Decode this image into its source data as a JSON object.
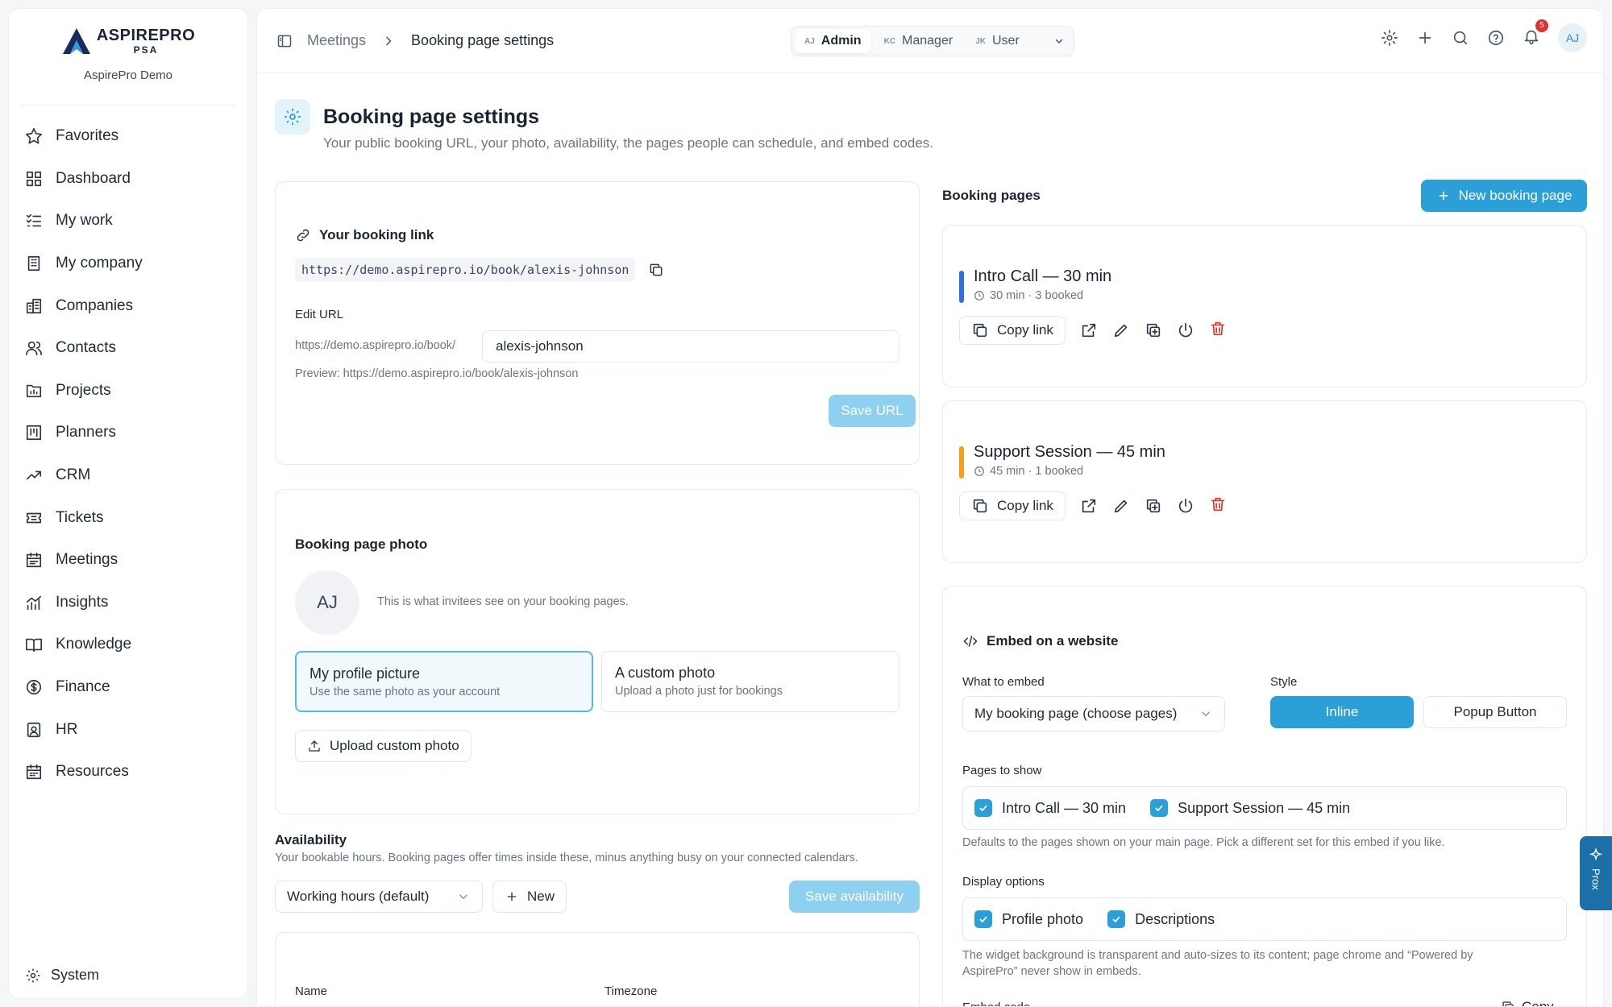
{
  "brand": {
    "name": "ASPIREPRO",
    "sub": "PSA",
    "org": "AspirePro Demo"
  },
  "nav": [
    {
      "label": "Favorites",
      "icon": "star-icon"
    },
    {
      "label": "Dashboard",
      "icon": "grid-icon"
    },
    {
      "label": "My work",
      "icon": "list-check-icon"
    },
    {
      "label": "My company",
      "icon": "building-icon"
    },
    {
      "label": "Companies",
      "icon": "buildings-icon"
    },
    {
      "label": "Contacts",
      "icon": "users-icon"
    },
    {
      "label": "Projects",
      "icon": "folder-chart-icon"
    },
    {
      "label": "Planners",
      "icon": "kanban-icon"
    },
    {
      "label": "CRM",
      "icon": "trend-up-icon"
    },
    {
      "label": "Tickets",
      "icon": "ticket-icon"
    },
    {
      "label": "Meetings",
      "icon": "calendar-icon"
    },
    {
      "label": "Insights",
      "icon": "bar-chart-icon"
    },
    {
      "label": "Knowledge",
      "icon": "book-icon"
    },
    {
      "label": "Finance",
      "icon": "dollar-icon"
    },
    {
      "label": "HR",
      "icon": "id-badge-icon"
    },
    {
      "label": "Resources",
      "icon": "calendar-grid-icon"
    }
  ],
  "system_label": "System",
  "breadcrumb": {
    "parent": "Meetings",
    "current": "Booking page settings"
  },
  "roles": [
    {
      "initials": "AJ",
      "label": "Admin",
      "active": true
    },
    {
      "initials": "KC",
      "label": "Manager",
      "active": false
    },
    {
      "initials": "JK",
      "label": "User",
      "active": false
    }
  ],
  "notifications_count": "5",
  "user_initials": "AJ",
  "page": {
    "title": "Booking page settings",
    "subtitle": "Your public booking URL, your photo, availability, the pages people can schedule, and embed codes."
  },
  "booking_link": {
    "title": "Your booking link",
    "url": "https://demo.aspirepro.io/book/alexis-johnson",
    "edit_label": "Edit URL",
    "prefix": "https://demo.aspirepro.io/book/",
    "slug": "alexis-johnson",
    "preview": "Preview: https://demo.aspirepro.io/book/alexis-johnson",
    "save_label": "Save URL"
  },
  "photo": {
    "title": "Booking page photo",
    "initials": "AJ",
    "hint": "This is what invitees see on your booking pages.",
    "options": [
      {
        "title": "My profile picture",
        "desc": "Use the same photo as your account"
      },
      {
        "title": "A custom photo",
        "desc": "Upload a photo just for bookings"
      }
    ],
    "upload_label": "Upload custom photo"
  },
  "availability": {
    "title": "Availability",
    "desc": "Your bookable hours. Booking pages offer times inside these, minus anything busy on your connected calendars.",
    "schedule": "Working hours (default)",
    "new_label": "New",
    "save_label": "Save availability",
    "col_name": "Name",
    "col_timezone": "Timezone"
  },
  "booking_pages": {
    "title": "Booking pages",
    "new_label": "New booking page",
    "items": [
      {
        "title": "Intro Call — 30 min",
        "meta": "30 min · 3 booked",
        "color": "#2f6fe0",
        "copy": "Copy link"
      },
      {
        "title": "Support Session — 45 min",
        "meta": "45 min · 1 booked",
        "color": "#f0a01e",
        "copy": "Copy link"
      }
    ]
  },
  "embed": {
    "title": "Embed on a website",
    "what_label": "What to embed",
    "what_value": "My booking page (choose pages)",
    "style_label": "Style",
    "style_inline": "Inline",
    "style_popup": "Popup Button",
    "pages_label": "Pages to show",
    "pages": [
      "Intro Call — 30 min",
      "Support Session — 45 min"
    ],
    "pages_hint": "Defaults to the pages shown on your main page. Pick a different set for this embed if you like.",
    "display_label": "Display options",
    "display": [
      "Profile photo",
      "Descriptions"
    ],
    "display_hint": "The widget background is transparent and auto-sizes to its content; page chrome and “Powered by AspirePro” never show in embeds.",
    "code_label": "Embed code",
    "copy_label": "Copy"
  },
  "prox_label": "Prox"
}
